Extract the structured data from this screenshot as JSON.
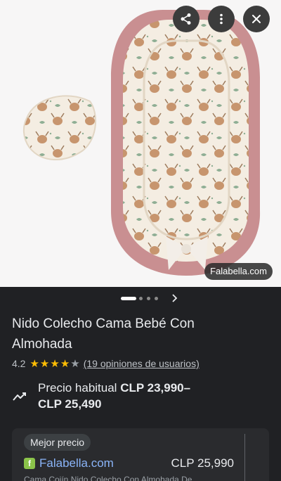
{
  "image_viewer": {
    "source_label": "Falabella.com",
    "share_icon": "share-icon",
    "more_icon": "more-vert-icon",
    "close_icon": "close-icon"
  },
  "carousel": {
    "dot_count": 4,
    "active_index": 0,
    "next_icon": "chevron-right-icon"
  },
  "product": {
    "title": "Nido Colecho Cama Bebé Con Almohada",
    "rating": "4.2",
    "rating_value": 4.2,
    "stars_full": 4,
    "stars_total": 5,
    "reviews_text": "(19 opiniones de usuarios)"
  },
  "price": {
    "icon": "trend-line-icon",
    "label": "Precio habitual",
    "range": "CLP 23,990–",
    "range_end": "CLP 25,490"
  },
  "offer": {
    "badge": "Mejor precio",
    "merchant_logo_letter": "f",
    "merchant": "Falabella.com",
    "price": "CLP 25,990",
    "description": "Cama Cojín Nido Colecho Con Almohada De..."
  },
  "colors": {
    "background": "#202124",
    "image_background": "#f7f6f6",
    "star": "#fbbc04",
    "link": "#8ab4f8",
    "merchant_logo": "#8bc34a",
    "nest_border": "#c98f91"
  }
}
